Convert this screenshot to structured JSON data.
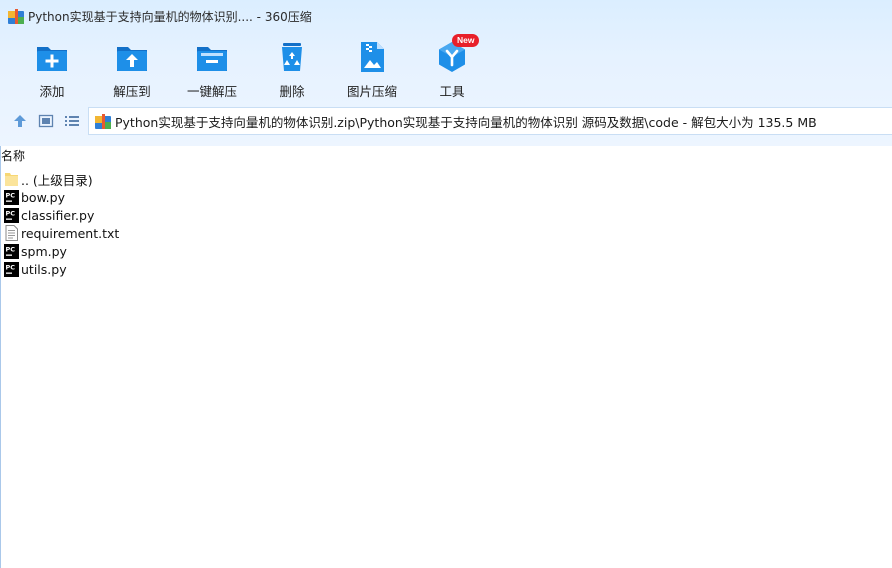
{
  "window": {
    "title": "Python实现基于支持向量机的物体识别.... - 360压缩"
  },
  "toolbar": {
    "items": [
      {
        "label": "添加",
        "icon": "add-folder-icon"
      },
      {
        "label": "解压到",
        "icon": "extract-to-folder-icon"
      },
      {
        "label": "一键解压",
        "icon": "one-click-extract-icon"
      },
      {
        "label": "删除",
        "icon": "recycle-bin-icon"
      },
      {
        "label": "图片压缩",
        "icon": "image-compress-icon"
      },
      {
        "label": "工具",
        "icon": "tools-cube-icon",
        "badge": "New"
      }
    ]
  },
  "address": {
    "path": "Python实现基于支持向量机的物体识别.zip\\Python实现基于支持向量机的物体识别 源码及数据\\code - 解包大小为 135.5 MB"
  },
  "columns": {
    "name": "名称"
  },
  "files": [
    {
      "name": ".. (上级目录)",
      "type": "folder"
    },
    {
      "name": "bow.py",
      "type": "pycharm"
    },
    {
      "name": "classifier.py",
      "type": "pycharm"
    },
    {
      "name": "requirement.txt",
      "type": "text"
    },
    {
      "name": "spm.py",
      "type": "pycharm"
    },
    {
      "name": "utils.py",
      "type": "pycharm"
    }
  ],
  "colors": {
    "accent": "#1e8fe8",
    "accent_dark": "#1370c8",
    "badge": "#e8202a"
  }
}
